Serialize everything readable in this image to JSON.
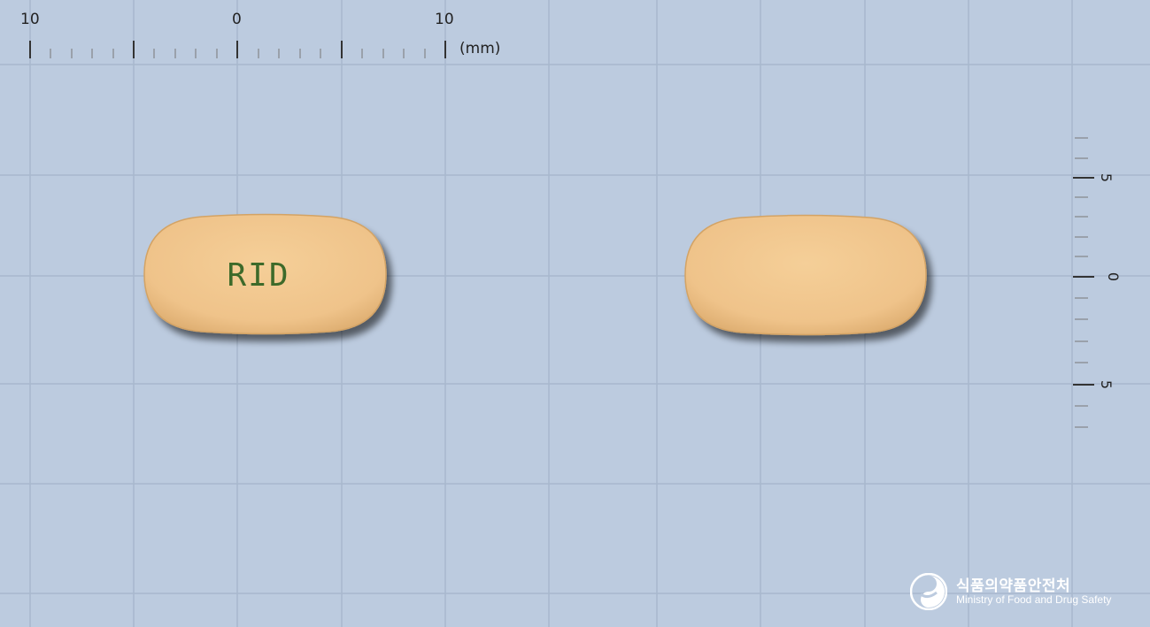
{
  "ruler": {
    "top_labels": [
      "10",
      "0",
      "10"
    ],
    "unit": "(mm)",
    "side_labels": [
      "5",
      "0",
      "5"
    ]
  },
  "pill_front": {
    "imprint": "RID"
  },
  "pill_back": {
    "imprint": ""
  },
  "colors": {
    "background": "#bccbdf",
    "grid_line": "#a6b7cc",
    "pill_fill": "#f0c68e",
    "pill_edge": "#d9a96c",
    "imprint": "#3d6a2a"
  },
  "logo": {
    "korean": "식품의약품안전처",
    "english": "Ministry of Food and Drug Safety"
  }
}
